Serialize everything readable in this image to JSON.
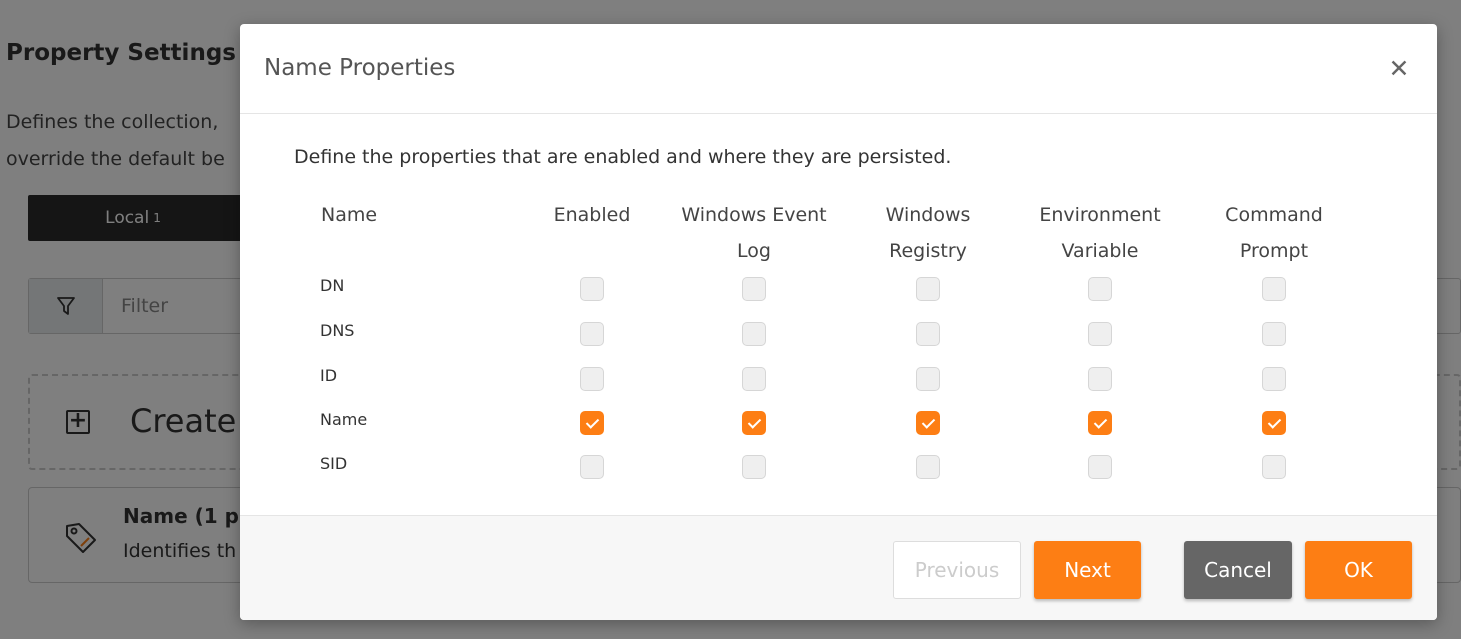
{
  "background": {
    "title": "Property Settings",
    "description_line1": "Defines the collection,",
    "description_line2": "override the default be",
    "tab_label": "Local",
    "tab_count": "1",
    "filter_placeholder": "Filter",
    "create_label": "Create",
    "card_title": "Name (1 p",
    "card_desc": "Identifies th"
  },
  "modal": {
    "title": "Name Properties",
    "close_icon": "close-icon",
    "close_glyph": "✕",
    "description": "Define the properties that are enabled and where they are persisted.",
    "columns": {
      "name": "Name",
      "enabled": "Enabled",
      "event_log_line1": "Windows Event",
      "event_log_line2": "Log",
      "registry_line1": "Windows",
      "registry_line2": "Registry",
      "env_line1": "Environment",
      "env_line2": "Variable",
      "cmd_line1": "Command",
      "cmd_line2": "Prompt"
    },
    "rows": [
      {
        "name": "DN",
        "enabled": false,
        "event_log": false,
        "registry": false,
        "env": false,
        "cmd": false
      },
      {
        "name": "DNS",
        "enabled": false,
        "event_log": false,
        "registry": false,
        "env": false,
        "cmd": false
      },
      {
        "name": "ID",
        "enabled": false,
        "event_log": false,
        "registry": false,
        "env": false,
        "cmd": false
      },
      {
        "name": "Name",
        "enabled": true,
        "event_log": true,
        "registry": true,
        "env": true,
        "cmd": true
      },
      {
        "name": "SID",
        "enabled": false,
        "event_log": false,
        "registry": false,
        "env": false,
        "cmd": false
      }
    ],
    "footer": {
      "previous": "Previous",
      "next": "Next",
      "cancel": "Cancel",
      "ok": "OK"
    }
  },
  "colors": {
    "accent": "#fd7e14",
    "cancel": "#666666"
  }
}
